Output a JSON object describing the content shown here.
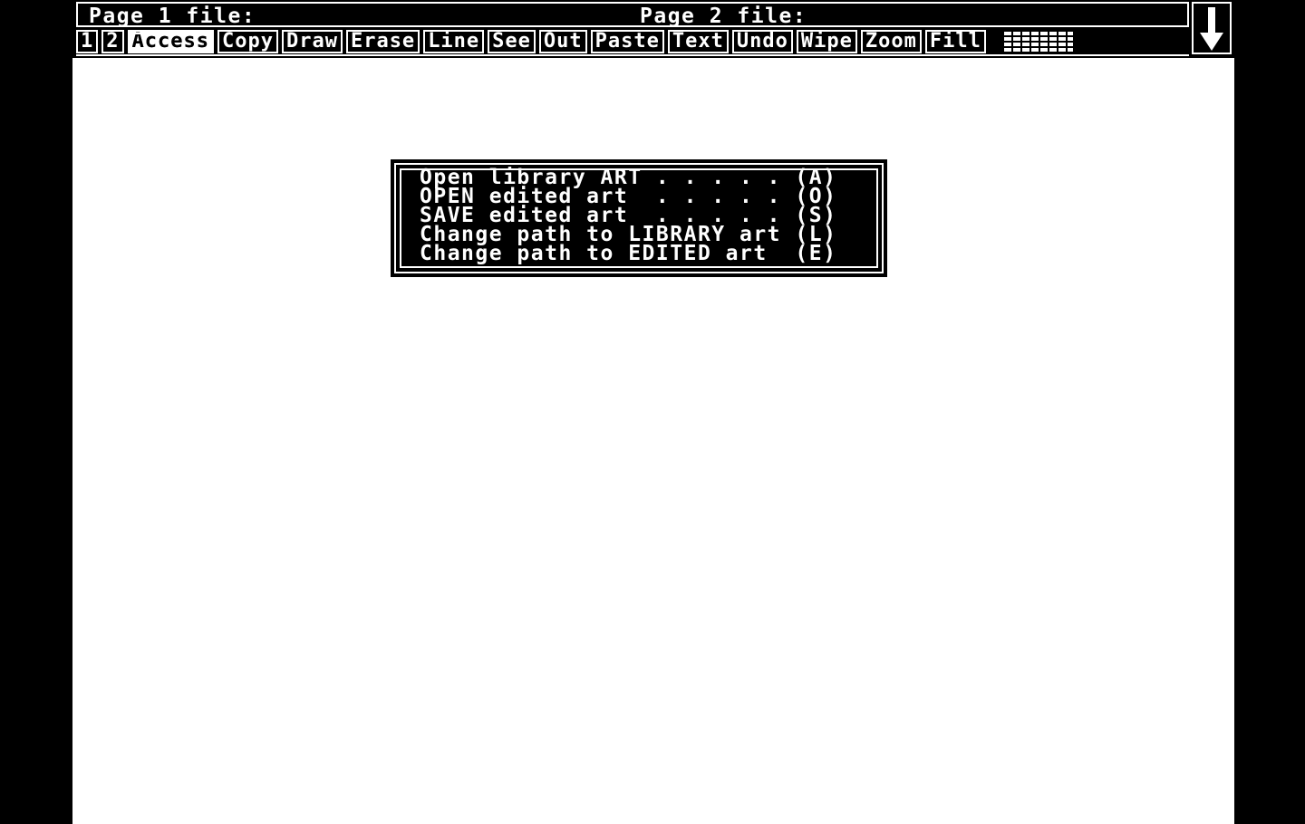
{
  "status_bar": {
    "page1_label": "Page 1 file:",
    "page2_label": "Page 2 file:"
  },
  "menu": {
    "items": [
      {
        "label": "1",
        "active": false
      },
      {
        "label": "2",
        "active": false
      },
      {
        "label": "Access",
        "active": true
      },
      {
        "label": "Copy",
        "active": false
      },
      {
        "label": "Draw",
        "active": false
      },
      {
        "label": "Erase",
        "active": false
      },
      {
        "label": "Line",
        "active": false
      },
      {
        "label": "See",
        "active": false
      },
      {
        "label": "Out",
        "active": false
      },
      {
        "label": "Paste",
        "active": false
      },
      {
        "label": "Text",
        "active": false
      },
      {
        "label": "Undo",
        "active": false
      },
      {
        "label": "Wipe",
        "active": false
      },
      {
        "label": "Zoom",
        "active": false
      },
      {
        "label": "Fill",
        "active": false
      }
    ],
    "scroll_icon": "down-arrow-icon",
    "pattern_icon": "fill-pattern-icon"
  },
  "access_dialog": {
    "options": [
      {
        "label": "Open library ART . . . . . (A)",
        "key": "A"
      },
      {
        "label": "OPEN edited art  . . . . . (O)",
        "key": "O"
      },
      {
        "label": "SAVE edited art  . . . . . (S)",
        "key": "S"
      },
      {
        "label": "Change path to LIBRARY art (L)",
        "key": "L"
      },
      {
        "label": "Change path to EDITED art  (E)",
        "key": "E"
      }
    ]
  },
  "colors": {
    "background": "#000000",
    "canvas": "#ffffff",
    "foreground": "#ffffff"
  }
}
